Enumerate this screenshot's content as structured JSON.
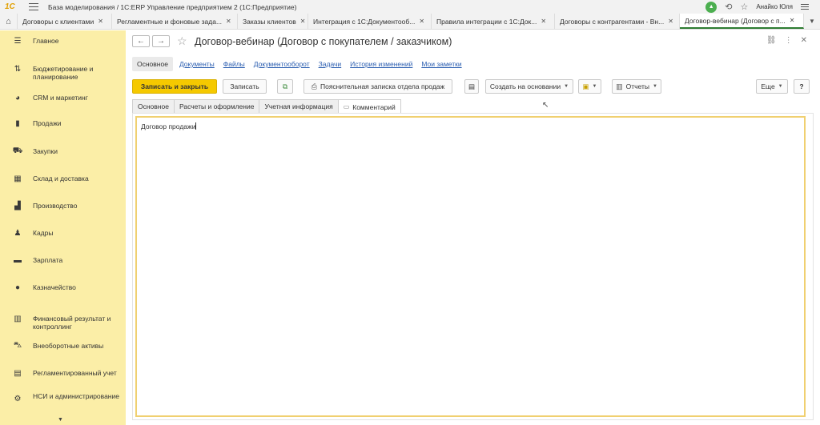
{
  "app": {
    "logo": "1С",
    "title": "База моделирования / 1С:ERP Управление предприятием 2  (1С:Предприятие)",
    "user": "Анайко Юля"
  },
  "tabs": [
    {
      "label": "Договоры с клиентами",
      "active": false
    },
    {
      "label": "Регламентные и фоновые зада...",
      "active": false
    },
    {
      "label": "Заказы клиентов",
      "active": false
    },
    {
      "label": "Интеграция с 1С:Документооб...",
      "active": false
    },
    {
      "label": "Правила интеграции с 1С:Док...",
      "active": false
    },
    {
      "label": "Договоры с контрагентами - Вн...",
      "active": false
    },
    {
      "label": "Договор-вебинар (Договор с п...",
      "active": true
    }
  ],
  "sidebar": {
    "items": [
      {
        "label": "Главное",
        "icon": "hamburger-icon"
      },
      {
        "label": "Бюджетирование и планирование",
        "icon": "budget-icon"
      },
      {
        "label": "CRM и маркетинг",
        "icon": "pie-chart-icon"
      },
      {
        "label": "Продажи",
        "icon": "bag-icon"
      },
      {
        "label": "Закупки",
        "icon": "cart-icon"
      },
      {
        "label": "Склад и доставка",
        "icon": "warehouse-icon"
      },
      {
        "label": "Производство",
        "icon": "factory-icon"
      },
      {
        "label": "Кадры",
        "icon": "person-icon"
      },
      {
        "label": "Зарплата",
        "icon": "wallet-icon"
      },
      {
        "label": "Казначейство",
        "icon": "coin-icon"
      },
      {
        "label": "Финансовый результат и контроллинг",
        "icon": "bar-chart-icon"
      },
      {
        "label": "Внеоборотные активы",
        "icon": "car-icon"
      },
      {
        "label": "Регламентированный учет",
        "icon": "ledger-icon"
      },
      {
        "label": "НСИ и администрирование",
        "icon": "gear-icon"
      }
    ]
  },
  "form": {
    "title": "Договор-вебинар (Договор с покупателем / заказчиком)",
    "sections": [
      "Основное",
      "Документы",
      "Файлы",
      "Документооборот",
      "Задачи",
      "История изменений",
      "Мои заметки"
    ],
    "toolbar": {
      "save_close": "Записать и закрыть",
      "save": "Записать",
      "explanatory_note": "Пояснительная записка отдела продаж",
      "create_based": "Создать на основании",
      "reports": "Отчеты",
      "more": "Еще",
      "help": "?"
    },
    "tabs": [
      "Основное",
      "Расчеты и оформление",
      "Учетная информация",
      "Комментарий"
    ],
    "comment": "Договор продажи"
  }
}
